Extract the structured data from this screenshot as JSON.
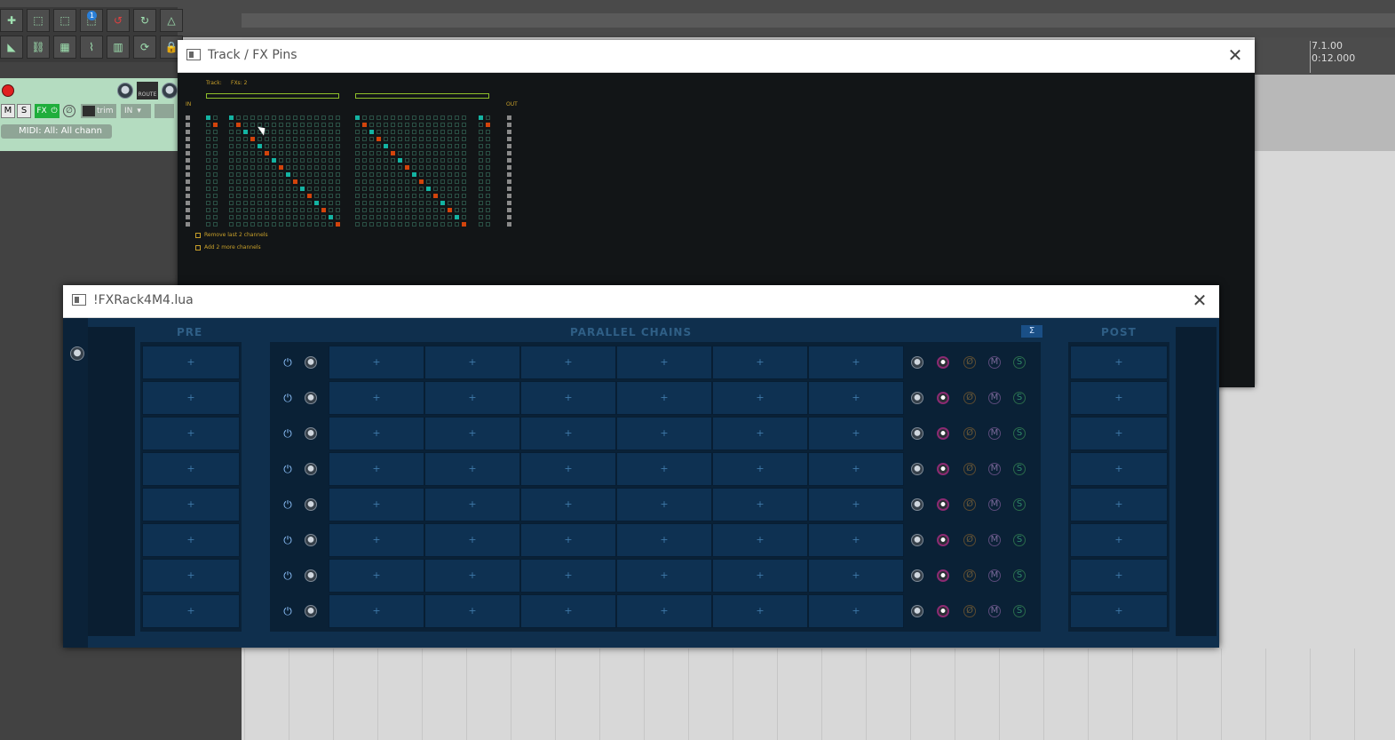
{
  "daw": {
    "ruler_time_top": "7.1.00",
    "ruler_time_bottom": "0:12.000",
    "track": {
      "buttons": [
        "M",
        "S",
        "FX"
      ],
      "route_label": "ROUTE",
      "trim_label": "trim",
      "in_label": "IN",
      "midi_input": "MIDI: All: All chann"
    },
    "toolbar_badge": "1",
    "colors": {
      "track_panel": "#b4dcc0",
      "rec_arm": "#e02020",
      "fx_active": "#1fae3c"
    }
  },
  "pins_window": {
    "title": "Track / FX Pins",
    "close_icon": "close-icon",
    "track_label": "Track:",
    "fx_label": "FXs: 2",
    "in_label": "IN",
    "out_label": "OUT",
    "option_remove": "Remove last 2 channels",
    "option_add": "Add 2 more channels",
    "colors": {
      "input_pin": "#14b3a2",
      "output_pin": "#d2440c",
      "grid": "#2a4f44",
      "label": "#c8a02a"
    }
  },
  "rack_window": {
    "title": "!FXRack4M4.lua",
    "close_icon": "close-icon",
    "pre_title": "PRE",
    "parallel_title": "PARALLEL CHAINS",
    "post_title": "POST",
    "sum_icon": "Σ",
    "slot_label": "+",
    "row_count": 8,
    "chain_columns": 6,
    "row_controls": [
      "power-icon",
      "volume-knob-icon"
    ],
    "row_right_controls": [
      "volume-knob-icon",
      "pan-knob-icon",
      "phase-icon",
      "mute-icon",
      "solo-icon"
    ],
    "row_right_glyphs": [
      "",
      "",
      "Ø",
      "M",
      "S"
    ],
    "colors": {
      "panel": "#0f2f4d",
      "slot": "#0e3152",
      "accent": "#3f79a8"
    }
  }
}
